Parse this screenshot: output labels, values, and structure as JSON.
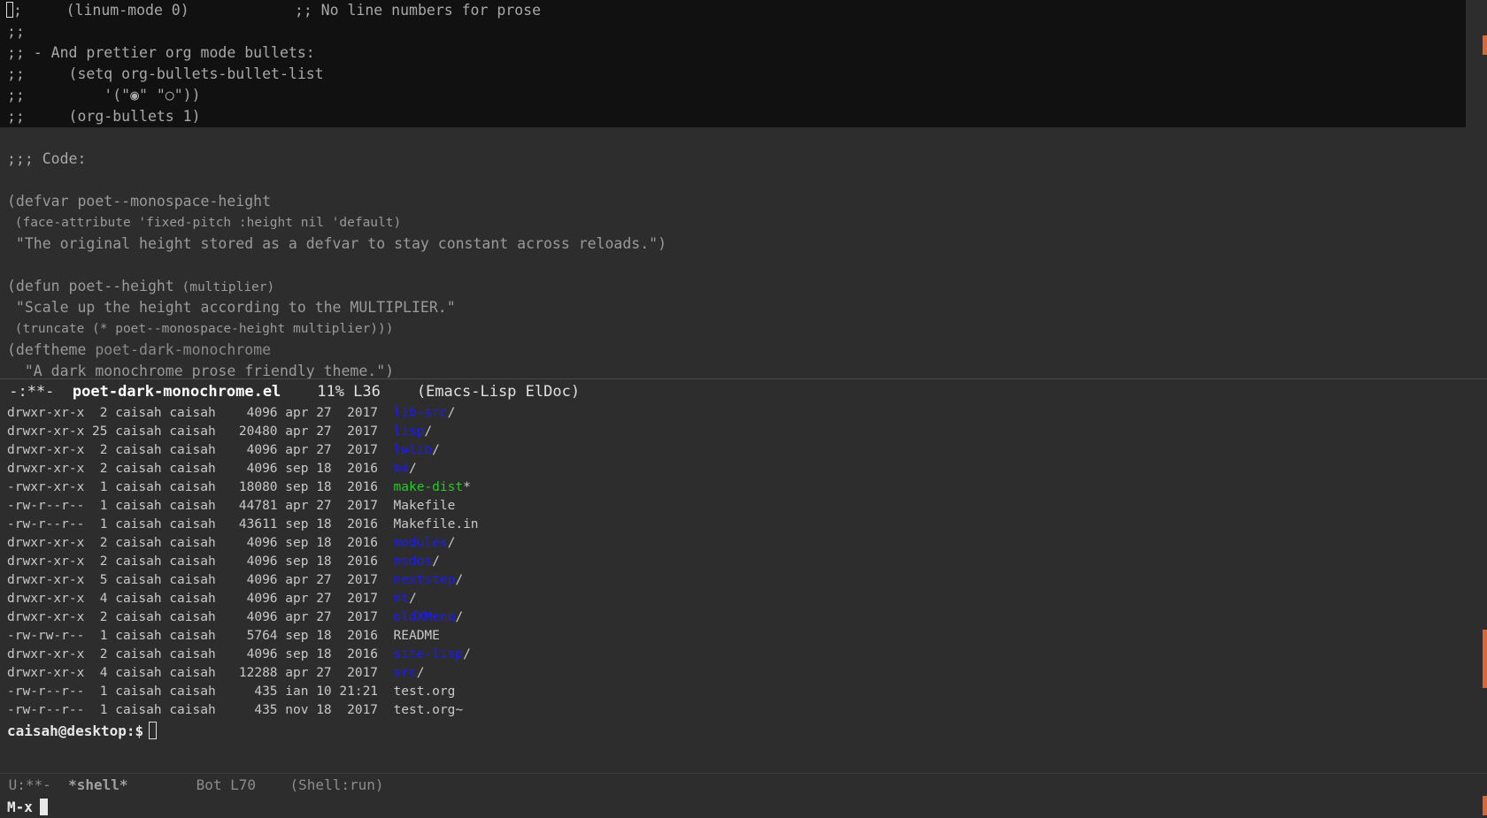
{
  "editor": {
    "comment_lines": [
      ";     (linum-mode 0)            ;; No line numbers for prose",
      ";;",
      ";; - And prettier org mode bullets:",
      ";;     (setq org-bullets-bullet-list",
      ";;         '(\"◉\" \"○\"))",
      ";;     (org-bullets 1)"
    ],
    "code_line": ";;; Code:",
    "defvar_head": "(defvar poet--monospace-height",
    "defvar_body": " (face-attribute 'fixed-pitch :height nil 'default)",
    "defvar_doc": " \"The original height stored as a defvar to stay constant across reloads.\")",
    "defun_head": "(defun poet--height",
    "defun_args": " (multiplier)",
    "defun_doc": " \"Scale up the height according to the MULTIPLIER.\"",
    "defun_body": " (truncate (* poet--monospace-height multiplier)))",
    "deftheme_kw": "(deftheme",
    "deftheme_name": " poet-dark-monochrome",
    "deftheme_doc": "  \"A dark monochrome prose friendly theme.\")"
  },
  "modeline1": {
    "status": " -:**-  ",
    "buffer": "poet-dark-monochrome.el",
    "position": "    11% L36    ",
    "modes": "(Emacs-Lisp ElDoc)"
  },
  "shell": {
    "rows": [
      {
        "meta": "drwxr-xr-x  2 caisah caisah    4096 apr 27  2017  ",
        "name": "lib-src",
        "suffix": "/",
        "kind": "dir"
      },
      {
        "meta": "drwxr-xr-x 25 caisah caisah   20480 apr 27  2017  ",
        "name": "lisp",
        "suffix": "/",
        "kind": "dir"
      },
      {
        "meta": "drwxr-xr-x  2 caisah caisah    4096 apr 27  2017  ",
        "name": "lwlib",
        "suffix": "/",
        "kind": "dir"
      },
      {
        "meta": "drwxr-xr-x  2 caisah caisah    4096 sep 18  2016  ",
        "name": "m4",
        "suffix": "/",
        "kind": "dir"
      },
      {
        "meta": "-rwxr-xr-x  1 caisah caisah   18080 sep 18  2016  ",
        "name": "make-dist",
        "suffix": "*",
        "kind": "exec"
      },
      {
        "meta": "-rw-r--r--  1 caisah caisah   44781 apr 27  2017  ",
        "name": "Makefile",
        "suffix": "",
        "kind": "plain"
      },
      {
        "meta": "-rw-r--r--  1 caisah caisah   43611 sep 18  2016  ",
        "name": "Makefile.in",
        "suffix": "",
        "kind": "plain"
      },
      {
        "meta": "drwxr-xr-x  2 caisah caisah    4096 sep 18  2016  ",
        "name": "modules",
        "suffix": "/",
        "kind": "dir"
      },
      {
        "meta": "drwxr-xr-x  2 caisah caisah    4096 sep 18  2016  ",
        "name": "msdos",
        "suffix": "/",
        "kind": "dir"
      },
      {
        "meta": "drwxr-xr-x  5 caisah caisah    4096 apr 27  2017  ",
        "name": "nextstep",
        "suffix": "/",
        "kind": "dir"
      },
      {
        "meta": "drwxr-xr-x  4 caisah caisah    4096 apr 27  2017  ",
        "name": "nt",
        "suffix": "/",
        "kind": "dir"
      },
      {
        "meta": "drwxr-xr-x  2 caisah caisah    4096 apr 27  2017  ",
        "name": "oldXMenu",
        "suffix": "/",
        "kind": "dir"
      },
      {
        "meta": "-rw-rw-r--  1 caisah caisah    5764 sep 18  2016  ",
        "name": "README",
        "suffix": "",
        "kind": "plain"
      },
      {
        "meta": "drwxr-xr-x  2 caisah caisah    4096 sep 18  2016  ",
        "name": "site-lisp",
        "suffix": "/",
        "kind": "dir"
      },
      {
        "meta": "drwxr-xr-x  4 caisah caisah   12288 apr 27  2017  ",
        "name": "src",
        "suffix": "/",
        "kind": "dir"
      },
      {
        "meta": "-rw-r--r--  1 caisah caisah     435 ian 10 21:21  ",
        "name": "test.org",
        "suffix": "",
        "kind": "plain"
      },
      {
        "meta": "-rw-r--r--  1 caisah caisah     435 nov 18  2017  ",
        "name": "test.org~",
        "suffix": "",
        "kind": "plain"
      }
    ],
    "prompt": "caisah@desktop:$"
  },
  "modeline2": {
    "status": " U:**-  ",
    "buffer": "*shell*",
    "position": "        Bot L70    ",
    "modes": "(Shell:run)"
  },
  "minibuffer": {
    "label": "M-x"
  },
  "colors": {
    "directory": "#1a1aff",
    "executable": "#22cc22",
    "scroll_indicator": "#d4683a"
  }
}
